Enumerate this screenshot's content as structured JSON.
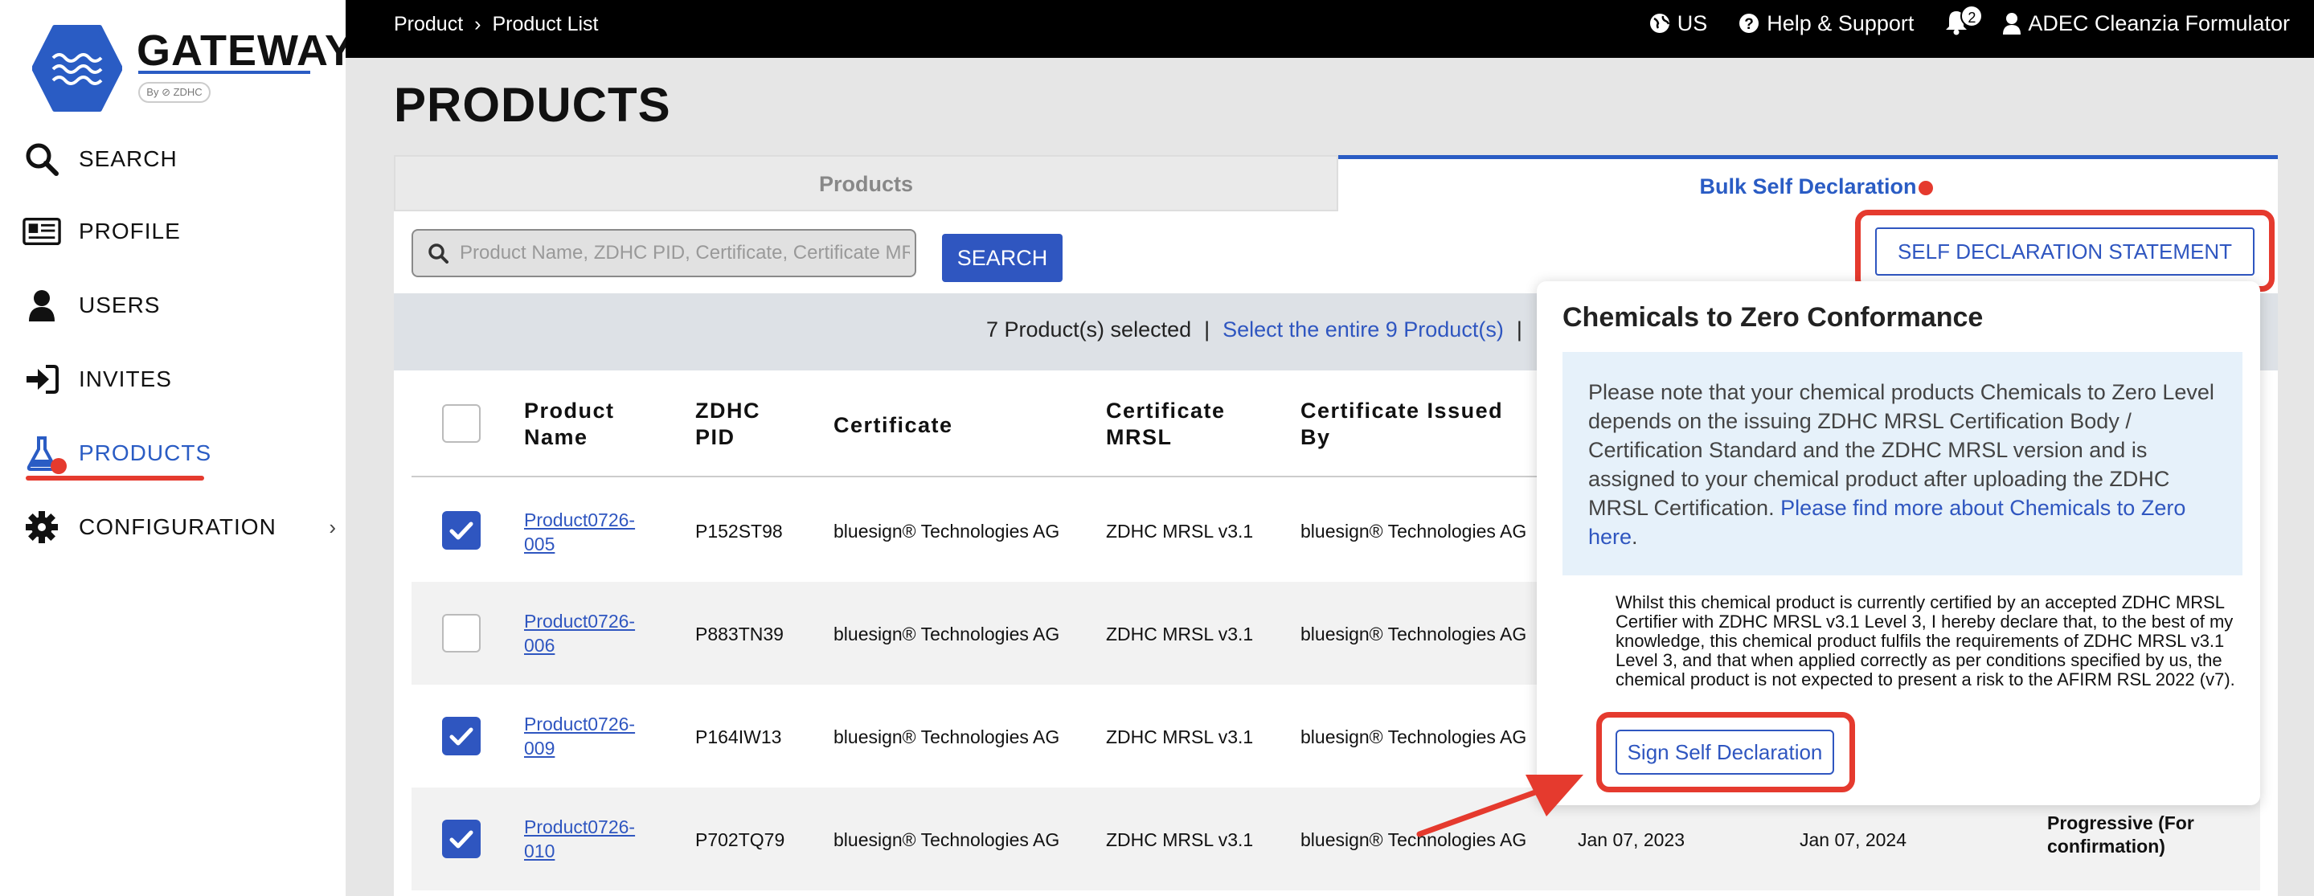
{
  "brand": {
    "name": "GATEWAY",
    "by": "By ⊘ ZDHC",
    "accent": "#2f56c0",
    "highlight": "#e53a2e"
  },
  "breadcrumb": [
    "Product",
    "Product List"
  ],
  "topbar": {
    "region": "US",
    "help": "Help & Support",
    "notifications": "2",
    "user": "ADEC Cleanzia Formulator"
  },
  "sidebar": {
    "items": [
      {
        "label": "SEARCH",
        "icon": "search-icon"
      },
      {
        "label": "PROFILE",
        "icon": "profile-card-icon"
      },
      {
        "label": "USERS",
        "icon": "user-icon"
      },
      {
        "label": "INVITES",
        "icon": "sign-in-icon"
      },
      {
        "label": "PRODUCTS",
        "icon": "flask-icon",
        "active": true
      },
      {
        "label": "CONFIGURATION",
        "icon": "gear-icon"
      }
    ]
  },
  "page": {
    "title": "PRODUCTS"
  },
  "tabs": [
    {
      "label": "Products"
    },
    {
      "label": "Bulk Self Declaration"
    }
  ],
  "search": {
    "placeholder": "Product Name, ZDHC PID, Certificate, Certificate MRSL",
    "button": "SEARCH"
  },
  "self_declaration_button": "SELF DECLARATION STATEMENT",
  "selection": {
    "selected_text": "7 Product(s) selected",
    "separator": "|",
    "select_all": "Select the entire 9 Product(s)"
  },
  "table": {
    "headers": {
      "name": "Product Name",
      "pid": "ZDHC PID",
      "certificate": "Certificate",
      "mrsl": "Certificate MRSL",
      "issued_by": "Certificate Issued By"
    },
    "rows": [
      {
        "checked": true,
        "name": "Product0726-005",
        "pid": "P152ST98",
        "certificate": "bluesign® Technologies AG",
        "mrsl": "ZDHC MRSL v3.1",
        "issued_by": "bluesign® Technologies AG"
      },
      {
        "checked": false,
        "name": "Product0726-006",
        "pid": "P883TN39",
        "certificate": "bluesign® Technologies AG",
        "mrsl": "ZDHC MRSL v3.1",
        "issued_by": "bluesign® Technologies AG"
      },
      {
        "checked": true,
        "name": "Product0726-009",
        "pid": "P164IW13",
        "certificate": "bluesign® Technologies AG",
        "mrsl": "ZDHC MRSL v3.1",
        "issued_by": "bluesign® Technologies AG"
      },
      {
        "checked": true,
        "name": "Product0726-010",
        "pid": "P702TQ79",
        "certificate": "bluesign® Technologies AG",
        "mrsl": "ZDHC MRSL v3.1",
        "issued_by": "bluesign® Technologies AG",
        "issue_date": "Jan 07, 2023",
        "expiry_date": "Jan 07, 2024",
        "conformance": "Progressive (For confirmation)"
      }
    ]
  },
  "popover": {
    "title": "Chemicals to Zero Conformance",
    "info": "Please note that your chemical products  Chemicals to Zero Level depends on the issuing ZDHC MRSL Certification Body / Certification Standard and the ZDHC MRSL version and is assigned to your chemical product after uploading the ZDHC MRSL Certification.",
    "info_link": "Please find more about Chemicals to Zero here",
    "info_end": ".",
    "declaration": "Whilst this chemical product is currently certified by an accepted ZDHC MRSL Certifier with ZDHC MRSL v3.1 Level 3, I hereby declare that, to the best of my knowledge, this chemical product fulfils the requirements of ZDHC MRSL v3.1 Level 3, and that when applied correctly as per conditions specified by us, the chemical product is not expected to present a risk to the AFIRM RSL 2022 (v7).",
    "sign_button": "Sign Self Declaration"
  }
}
